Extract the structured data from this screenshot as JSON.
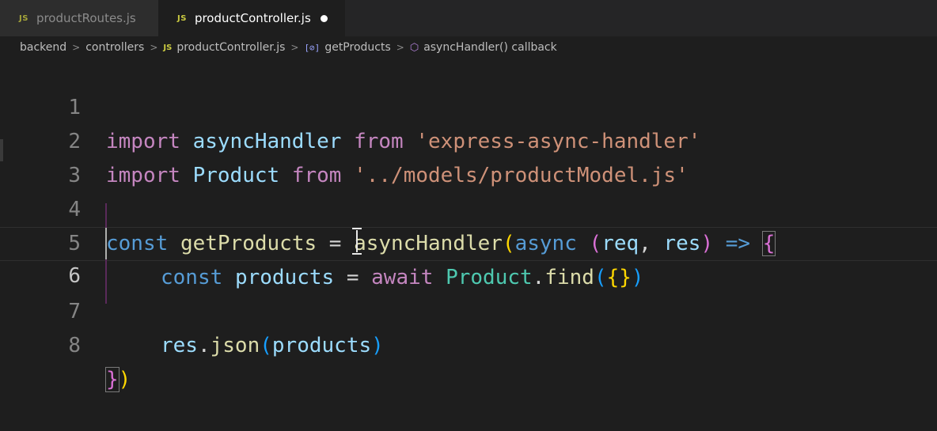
{
  "tabs": [
    {
      "label": "productRoutes.js",
      "badge": "JS",
      "active": false
    },
    {
      "label": "productController.js",
      "badge": "JS",
      "active": true,
      "dirty": true
    }
  ],
  "breadcrumb": {
    "items": [
      "backend",
      "controllers",
      "productController.js",
      "getProducts",
      "asyncHandler() callback"
    ],
    "icons": {
      "js": "JS",
      "symbol": "[⊘]",
      "cube": "⬡"
    }
  },
  "editor": {
    "line_numbers": [
      "1",
      "2",
      "3",
      "4",
      "5",
      "6",
      "7",
      "8"
    ],
    "lines": {
      "l1": {
        "kw1": "import",
        "id": "asyncHandler",
        "kw2": "from",
        "str": "'express-async-handler'"
      },
      "l2": {
        "kw1": "import",
        "id": "Product",
        "kw2": "from",
        "str": "'../models/productModel.js'"
      },
      "l4": {
        "kw": "const",
        "name": "getProducts",
        "eq": "=",
        "fn": "asyncHandler",
        "p1": "(",
        "async": "async",
        "p2": "(",
        "a1": "req",
        "comma": ",",
        "a2": "res",
        "p3": ")",
        "arrow": "=>",
        "brace": "{"
      },
      "l5": {
        "kw": "const",
        "name": "products",
        "eq": "=",
        "await": "await",
        "cls": "Product",
        "dot": ".",
        "fn": "find",
        "p1": "(",
        "b1": "{}",
        "p2": ")"
      },
      "l7": {
        "obj": "res",
        "dot": ".",
        "fn": "json",
        "p1": "(",
        "arg": "products",
        "p2": ")"
      },
      "l8": {
        "brace": "}",
        "paren": ")"
      }
    }
  },
  "colors": {
    "background": "#1e1e1e",
    "keyword": "#c586c0",
    "declaration": "#569cd6",
    "variable": "#9cdcfe",
    "function": "#dcdcaa",
    "string": "#ce9178",
    "class": "#4ec9b0"
  }
}
